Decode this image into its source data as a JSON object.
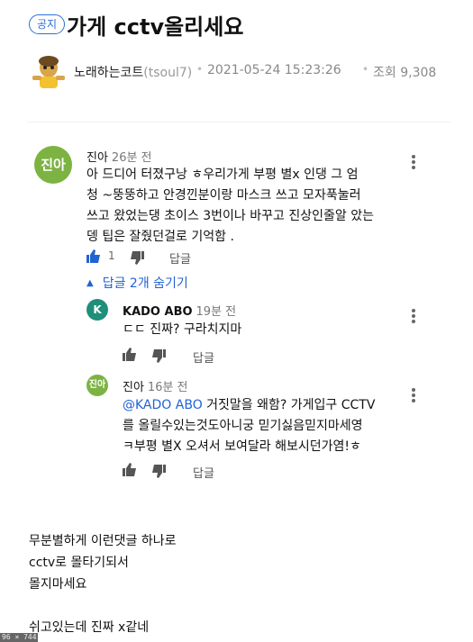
{
  "post": {
    "badge": "공지",
    "title": "가게 cctv올리세요",
    "author_name": "노래하는코트",
    "author_id": "(tsoul7)",
    "date": "2021-05-24 15:23:26",
    "views_label": "조회",
    "views": "9,308"
  },
  "comment": {
    "avatar_text": "진아",
    "author": "진아",
    "time": "26분 전",
    "lines": [
      "아 드디어 터졌구낭 ㅎ우리가게 부평 별x 인댕    그 엄",
      "청 ~뚱뚱하고 안경낀분이랑   마스크 쓰고 모자푹눌러",
      "쓰고 왔었는댕 초이스 3번이나 바꾸고 진상인줄알 았는",
      "뎅 팁은 잘줬던걸로 기억함 ."
    ],
    "like_count": "1",
    "reply_label": "답글",
    "toggle_label": "답글 2개 숨기기"
  },
  "replies": [
    {
      "avatar_text": "K",
      "author": "KADO ABO",
      "time": "19분 전",
      "lines": [
        "ㄷㄷ 진짜? 구라치지마"
      ],
      "reply_label": "답글"
    },
    {
      "avatar_text": "진아",
      "author": "진아",
      "time": "16분 전",
      "mention": "@KADO ABO",
      "lines": [
        " 거짓말을 왜함? 가게입구 CCTV",
        "를 올릴수있는것도아니궁 믿기싫음믿지마세영",
        "ㅋ부평 별X 오셔서 보여달라 해보시던가염!ㅎ"
      ],
      "reply_label": "답글"
    }
  ],
  "body": {
    "lines": [
      "무분별하게 이런댓글 하나로",
      "cctv로 몰타기되서",
      "몰지마세요",
      "쉬고있는데 진짜 x같네"
    ]
  },
  "corner_tag": "96 × 744",
  "colors": {
    "accent": "#2163d3",
    "avatar_green": "#7cb342",
    "avatar_teal": "#1f8f7a"
  }
}
